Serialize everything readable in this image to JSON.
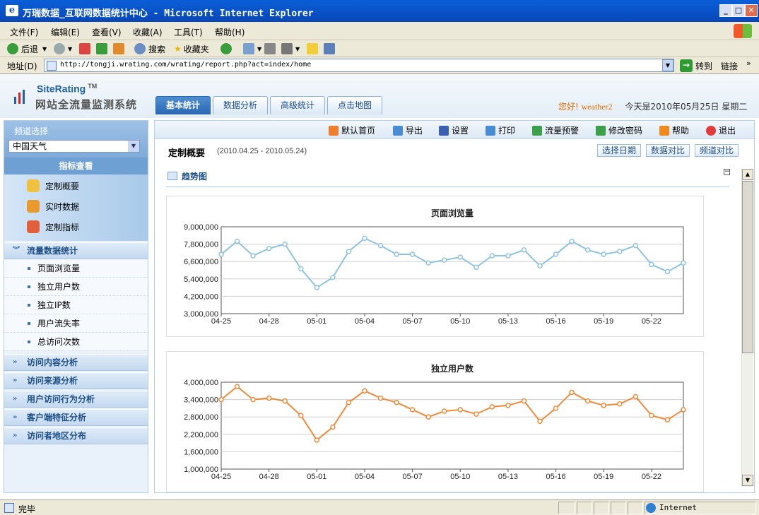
{
  "window": {
    "title": "万瑞数据_互联网数据统计中心 - Microsoft Internet Explorer"
  },
  "menu": [
    "文件(F)",
    "编辑(E)",
    "查看(V)",
    "收藏(A)",
    "工具(T)",
    "帮助(H)"
  ],
  "toolbar": {
    "back": "后退",
    "search": "搜索",
    "favorites": "收藏夹"
  },
  "address": {
    "label": "地址(D)",
    "url": "http://tongji.wrating.com/wrating/report.php?act=index/home",
    "go": "转到",
    "links": "链接"
  },
  "site": {
    "logo_brand": "SiteRating",
    "logo_tm": "TM",
    "logo_subtitle": "网站全流量监测系统",
    "tabs": [
      "基本统计",
      "数据分析",
      "高级统计",
      "点击地图"
    ],
    "greeting": "您好!",
    "username": "weather2",
    "date_text": "今天是2010年05月25日 星期二"
  },
  "sidebar": {
    "channel_label": "频道选择",
    "channel_value": "中国天气",
    "indicator_header": "指标查看",
    "indicators": [
      "定制概要",
      "实时数据",
      "定制指标"
    ],
    "section_traffic": "流量数据统计",
    "traffic_items": [
      "页面浏览量",
      "独立用户数",
      "独立IP数",
      "用户流失率",
      "总访问次数"
    ],
    "sections": [
      "访问内容分析",
      "访问来源分析",
      "用户访问行为分析",
      "客户端特征分析",
      "访问者地区分布"
    ]
  },
  "main": {
    "toolbar": [
      "默认首页",
      "导出",
      "设置",
      "打印",
      "流量预警",
      "修改密码",
      "帮助",
      "退出"
    ],
    "page_title": "定制概要",
    "page_range": "(2010.04.25 - 2010.05.24)",
    "buttons": [
      "选择日期",
      "数据对比",
      "频道对比"
    ],
    "trend_label": "趋势图",
    "collapse": "−"
  },
  "chart_data": [
    {
      "type": "line",
      "title": "页面浏览量",
      "x": [
        "04-25",
        "04-26",
        "04-27",
        "04-28",
        "04-29",
        "04-30",
        "05-01",
        "05-02",
        "05-03",
        "05-04",
        "05-05",
        "05-06",
        "05-07",
        "05-08",
        "05-09",
        "05-10",
        "05-11",
        "05-12",
        "05-13",
        "05-14",
        "05-15",
        "05-16",
        "05-17",
        "05-18",
        "05-19",
        "05-20",
        "05-21",
        "05-22",
        "05-23",
        "05-24"
      ],
      "xticks": [
        "04-25",
        "04-28",
        "05-01",
        "05-04",
        "05-07",
        "05-10",
        "05-13",
        "05-16",
        "05-19",
        "05-22"
      ],
      "values": [
        7100000,
        8000000,
        7000000,
        7500000,
        7800000,
        6100000,
        4800000,
        5500000,
        7300000,
        8200000,
        7700000,
        7100000,
        7100000,
        6500000,
        6700000,
        6900000,
        6200000,
        7000000,
        7000000,
        7400000,
        6300000,
        7100000,
        8000000,
        7400000,
        7100000,
        7300000,
        7700000,
        6400000,
        5900000,
        6500000
      ],
      "yticks": [
        "3,000,000",
        "4,200,000",
        "5,400,000",
        "6,600,000",
        "7,800,000",
        "9,000,000"
      ],
      "ylim": [
        3000000,
        9000000
      ],
      "color": "#8ec3df"
    },
    {
      "type": "line",
      "title": "独立用户数",
      "x": [
        "04-25",
        "04-26",
        "04-27",
        "04-28",
        "04-29",
        "04-30",
        "05-01",
        "05-02",
        "05-03",
        "05-04",
        "05-05",
        "05-06",
        "05-07",
        "05-08",
        "05-09",
        "05-10",
        "05-11",
        "05-12",
        "05-13",
        "05-14",
        "05-15",
        "05-16",
        "05-17",
        "05-18",
        "05-19",
        "05-20",
        "05-21",
        "05-22",
        "05-23",
        "05-24"
      ],
      "xticks": [
        "04-25",
        "04-28",
        "05-01",
        "05-04",
        "05-07",
        "05-10",
        "05-13",
        "05-16",
        "05-19",
        "05-22"
      ],
      "values": [
        3400000,
        3850000,
        3400000,
        3450000,
        3350000,
        2850000,
        2000000,
        2450000,
        3300000,
        3700000,
        3450000,
        3300000,
        3050000,
        2800000,
        3000000,
        3050000,
        2900000,
        3150000,
        3200000,
        3350000,
        2650000,
        3100000,
        3650000,
        3350000,
        3200000,
        3250000,
        3500000,
        2850000,
        2700000,
        3050000
      ],
      "yticks": [
        "1,000,000",
        "1,600,000",
        "2,200,000",
        "2,800,000",
        "3,400,000",
        "4,000,000"
      ],
      "ylim": [
        1000000,
        4000000
      ],
      "color": "#ef8a3a"
    }
  ],
  "status": {
    "text": "完毕",
    "zone": "Internet"
  }
}
